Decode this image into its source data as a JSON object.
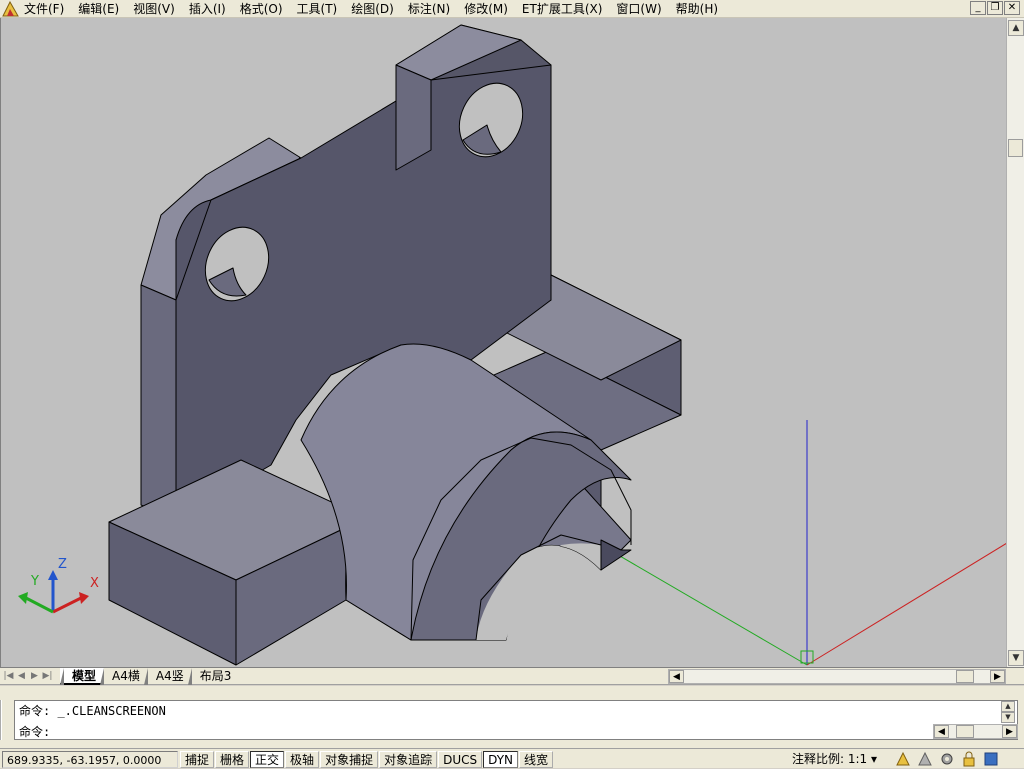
{
  "menubar": {
    "items": [
      "文件(F)",
      "编辑(E)",
      "视图(V)",
      "插入(I)",
      "格式(O)",
      "工具(T)",
      "绘图(D)",
      "标注(N)",
      "修改(M)",
      "ET扩展工具(X)",
      "窗口(W)",
      "帮助(H)"
    ]
  },
  "ucs": {
    "x_label": "X",
    "y_label": "Y",
    "z_label": "Z"
  },
  "tabs": {
    "items": [
      "模型",
      "A4横",
      "A4竖",
      "布局3"
    ],
    "active": "模型"
  },
  "command": {
    "line1": "命令: _.CLEANSCREENON",
    "line2": "命令:",
    "value": ""
  },
  "status": {
    "coords": "689.9335, -63.1957, 0.0000",
    "toggles": [
      {
        "label": "捕捉",
        "on": false
      },
      {
        "label": "栅格",
        "on": false
      },
      {
        "label": "正交",
        "on": true
      },
      {
        "label": "极轴",
        "on": false
      },
      {
        "label": "对象捕捉",
        "on": false
      },
      {
        "label": "对象追踪",
        "on": false
      },
      {
        "label": "DUCS",
        "on": false
      },
      {
        "label": "DYN",
        "on": true
      },
      {
        "label": "线宽",
        "on": false
      }
    ],
    "annotation_scale_label": "注释比例:",
    "annotation_scale_value": "1:1"
  },
  "colors": {
    "viewport_bg": "#c0c0c0",
    "solid_face_dark": "#5a5a6e",
    "solid_face_light": "#7a7a8c",
    "axis_x": "#cc2222",
    "axis_y": "#22aa22",
    "axis_z": "#2222cc"
  }
}
